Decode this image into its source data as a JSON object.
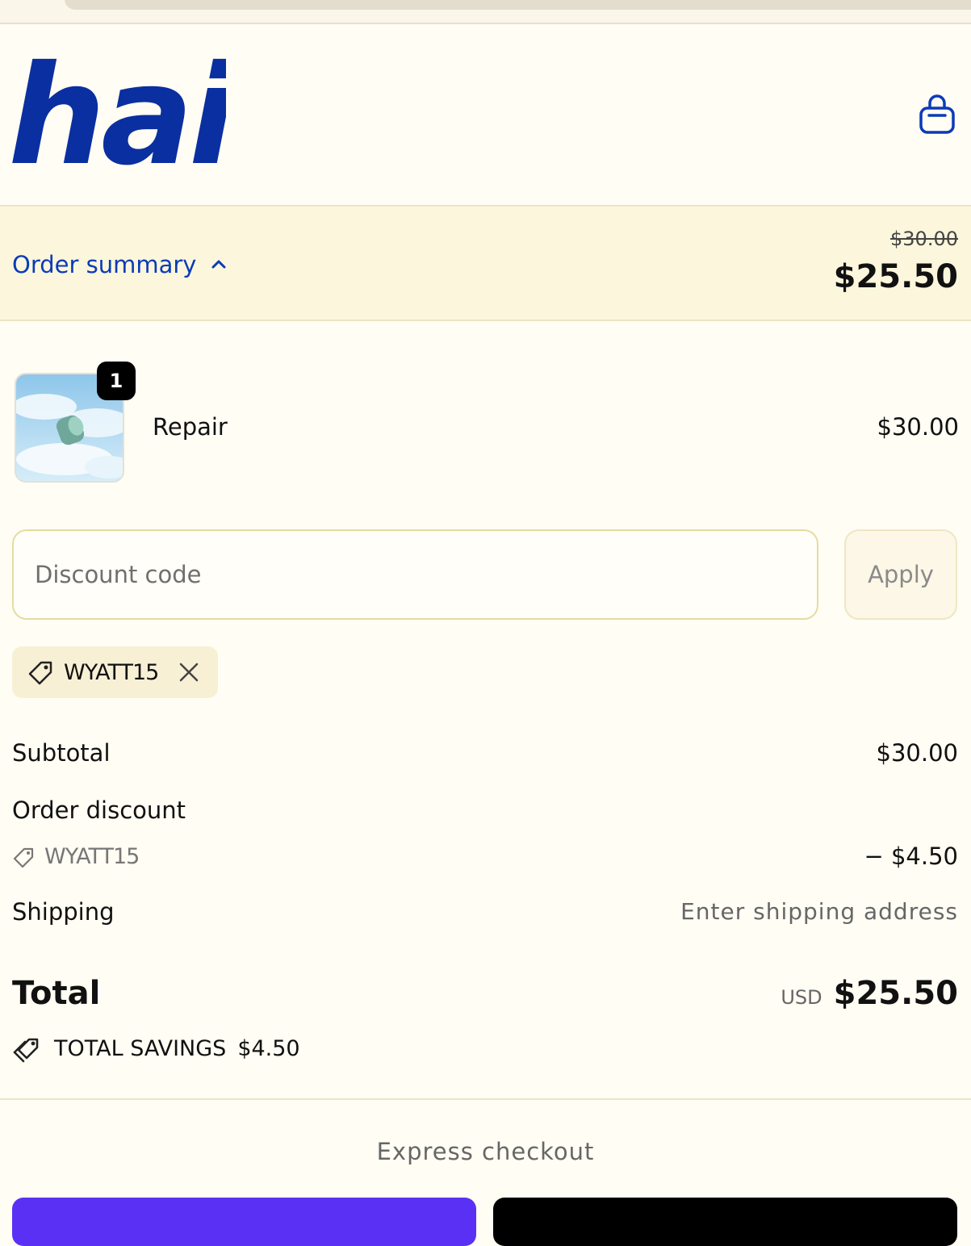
{
  "brand": {
    "logo_text": "hai",
    "color": "#0a2fa0"
  },
  "header": {
    "cart_icon": "shopping-bag-icon"
  },
  "summary_bar": {
    "toggle_label": "Order summary",
    "toggle_icon": "chevron-up-icon",
    "original_price": "$30.00",
    "total": "$25.50"
  },
  "cart": {
    "items": [
      {
        "name": "Repair",
        "quantity": "1",
        "price": "$30.00"
      }
    ]
  },
  "discount": {
    "placeholder": "Discount code",
    "apply_label": "Apply",
    "applied_code": "WYATT15"
  },
  "totals": {
    "subtotal_label": "Subtotal",
    "subtotal": "$30.00",
    "order_discount_label": "Order discount",
    "discount_code": "WYATT15",
    "discount_amount": "− $4.50",
    "shipping_label": "Shipping",
    "shipping_value": "Enter shipping address",
    "total_label": "Total",
    "currency": "USD",
    "total": "$25.50",
    "savings_label": "TOTAL SAVINGS",
    "savings_amount": "$4.50"
  },
  "express": {
    "label": "Express checkout",
    "buttons": [
      {
        "name": "shop-pay",
        "color": "#5a31f4"
      },
      {
        "name": "google-pay",
        "color": "#000000"
      }
    ]
  },
  "colors": {
    "accent": "#0a3bb8",
    "background": "#fffdf4",
    "summary_bg": "#fcf6dc"
  }
}
